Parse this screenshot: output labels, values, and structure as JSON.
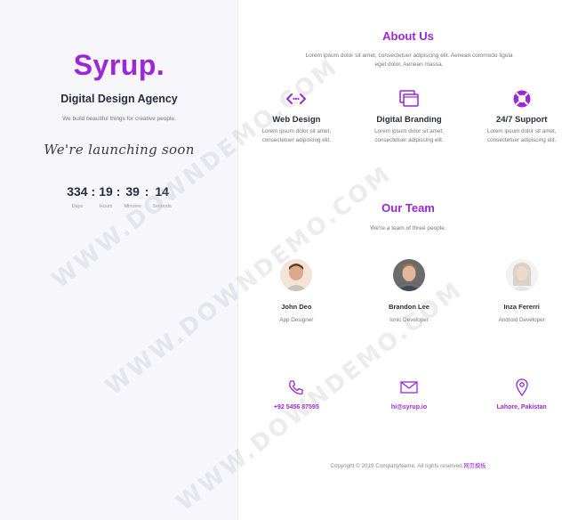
{
  "left": {
    "brand": "Syrup.",
    "tagline": "Digital Design Agency",
    "description": "We build beautiful things for creative people.",
    "launching": "We're launching soon",
    "countdown": [
      {
        "value": "334",
        "label": "Days"
      },
      {
        "value": "19",
        "label": "Hours"
      },
      {
        "value": "39",
        "label": "Minutes"
      },
      {
        "value": "14",
        "label": "Seconds"
      }
    ],
    "separator": ":"
  },
  "about": {
    "title": "About Us",
    "text": "Lorem ipsum dolor sit amet, consectetuer adipiscing elit. Aenean commodo ligula eget dolor. Aenean massa.",
    "services": [
      {
        "icon": "code-arrows-icon",
        "title": "Web Design",
        "text": "Lorem ipsum dolor sit amet, consectetuer adipiscing elit."
      },
      {
        "icon": "stacked-windows-icon",
        "title": "Digital Branding",
        "text": "Lorem ipsum dolor sit amet, consectetuer adipiscing elit."
      },
      {
        "icon": "lifebuoy-icon",
        "title": "24/7 Support",
        "text": "Lorem ipsum dolor sit amet, consectetuer adipiscing elit."
      }
    ]
  },
  "team": {
    "title": "Our Team",
    "subtitle": "We're a team of three people.",
    "members": [
      {
        "name": "John Deo",
        "role": "App Designer"
      },
      {
        "name": "Brandon Lee",
        "role": "Ionic Developer"
      },
      {
        "name": "Inza Fererri",
        "role": "Android Developer"
      }
    ]
  },
  "contact": {
    "items": [
      {
        "icon": "phone-icon",
        "text": "+92 5456 87595"
      },
      {
        "icon": "envelope-icon",
        "text": "hi@syrup.io"
      },
      {
        "icon": "map-pin-icon",
        "text": "Lahore, Pakistan"
      }
    ]
  },
  "footer": {
    "text": "Copyright © 2019 CompanyName. All rights reserved.",
    "link": "网页模板"
  },
  "watermark": "WWW.DOWNDEMO.COM",
  "colors": {
    "accent": "#9c27d6",
    "text": "#2b2b40",
    "muted": "#777777",
    "left_bg": "#f6f6fb"
  }
}
